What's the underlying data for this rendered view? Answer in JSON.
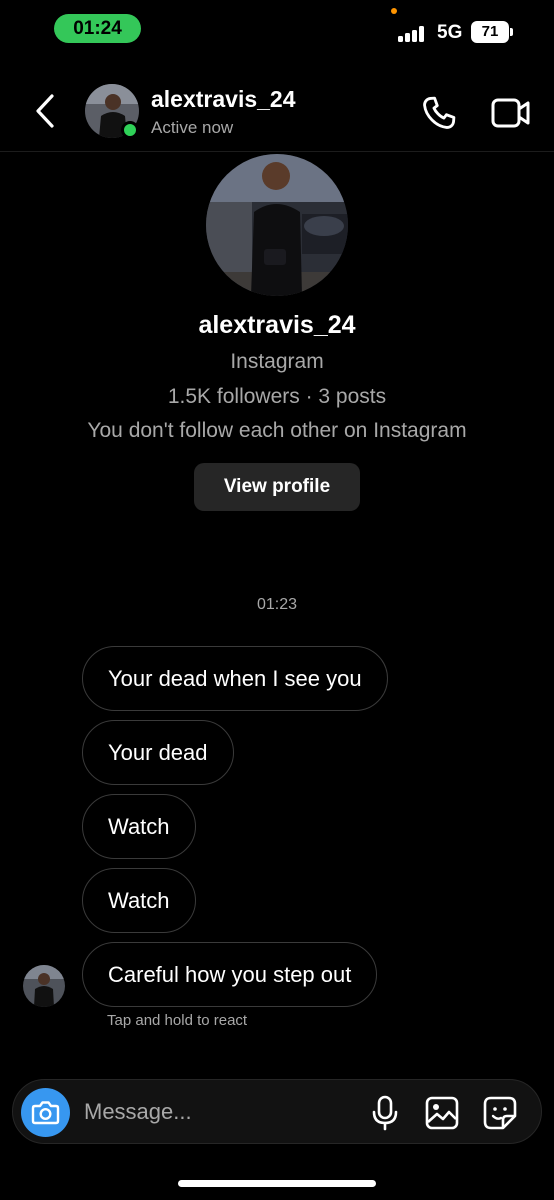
{
  "status_bar": {
    "time": "01:24",
    "network": "5G",
    "battery": "71"
  },
  "header": {
    "username": "alextravis_24",
    "status": "Active now",
    "icons": {
      "back": "chevron-left-icon",
      "call": "phone-icon",
      "video": "video-camera-icon"
    }
  },
  "profile": {
    "username": "alextravis_24",
    "platform": "Instagram",
    "stats": "1.5K followers · 3 posts",
    "relationship": "You don't follow each other on Instagram",
    "view_profile_label": "View profile"
  },
  "thread": {
    "timestamp": "01:23",
    "messages": [
      {
        "text": "Your dead when I see you"
      },
      {
        "text": "Your dead"
      },
      {
        "text": "Watch"
      },
      {
        "text": "Watch"
      },
      {
        "text": "Careful how you step out"
      }
    ],
    "react_hint": "Tap and hold to react"
  },
  "composer": {
    "placeholder": "Message...",
    "icons": {
      "camera": "camera-icon",
      "mic": "microphone-icon",
      "gallery": "image-icon",
      "sticker": "sticker-icon"
    },
    "accent_color": "#3797f0"
  },
  "colors": {
    "active": "#2fd158",
    "status_pill": "#34c759",
    "secondary_text": "#a8a8a8"
  }
}
